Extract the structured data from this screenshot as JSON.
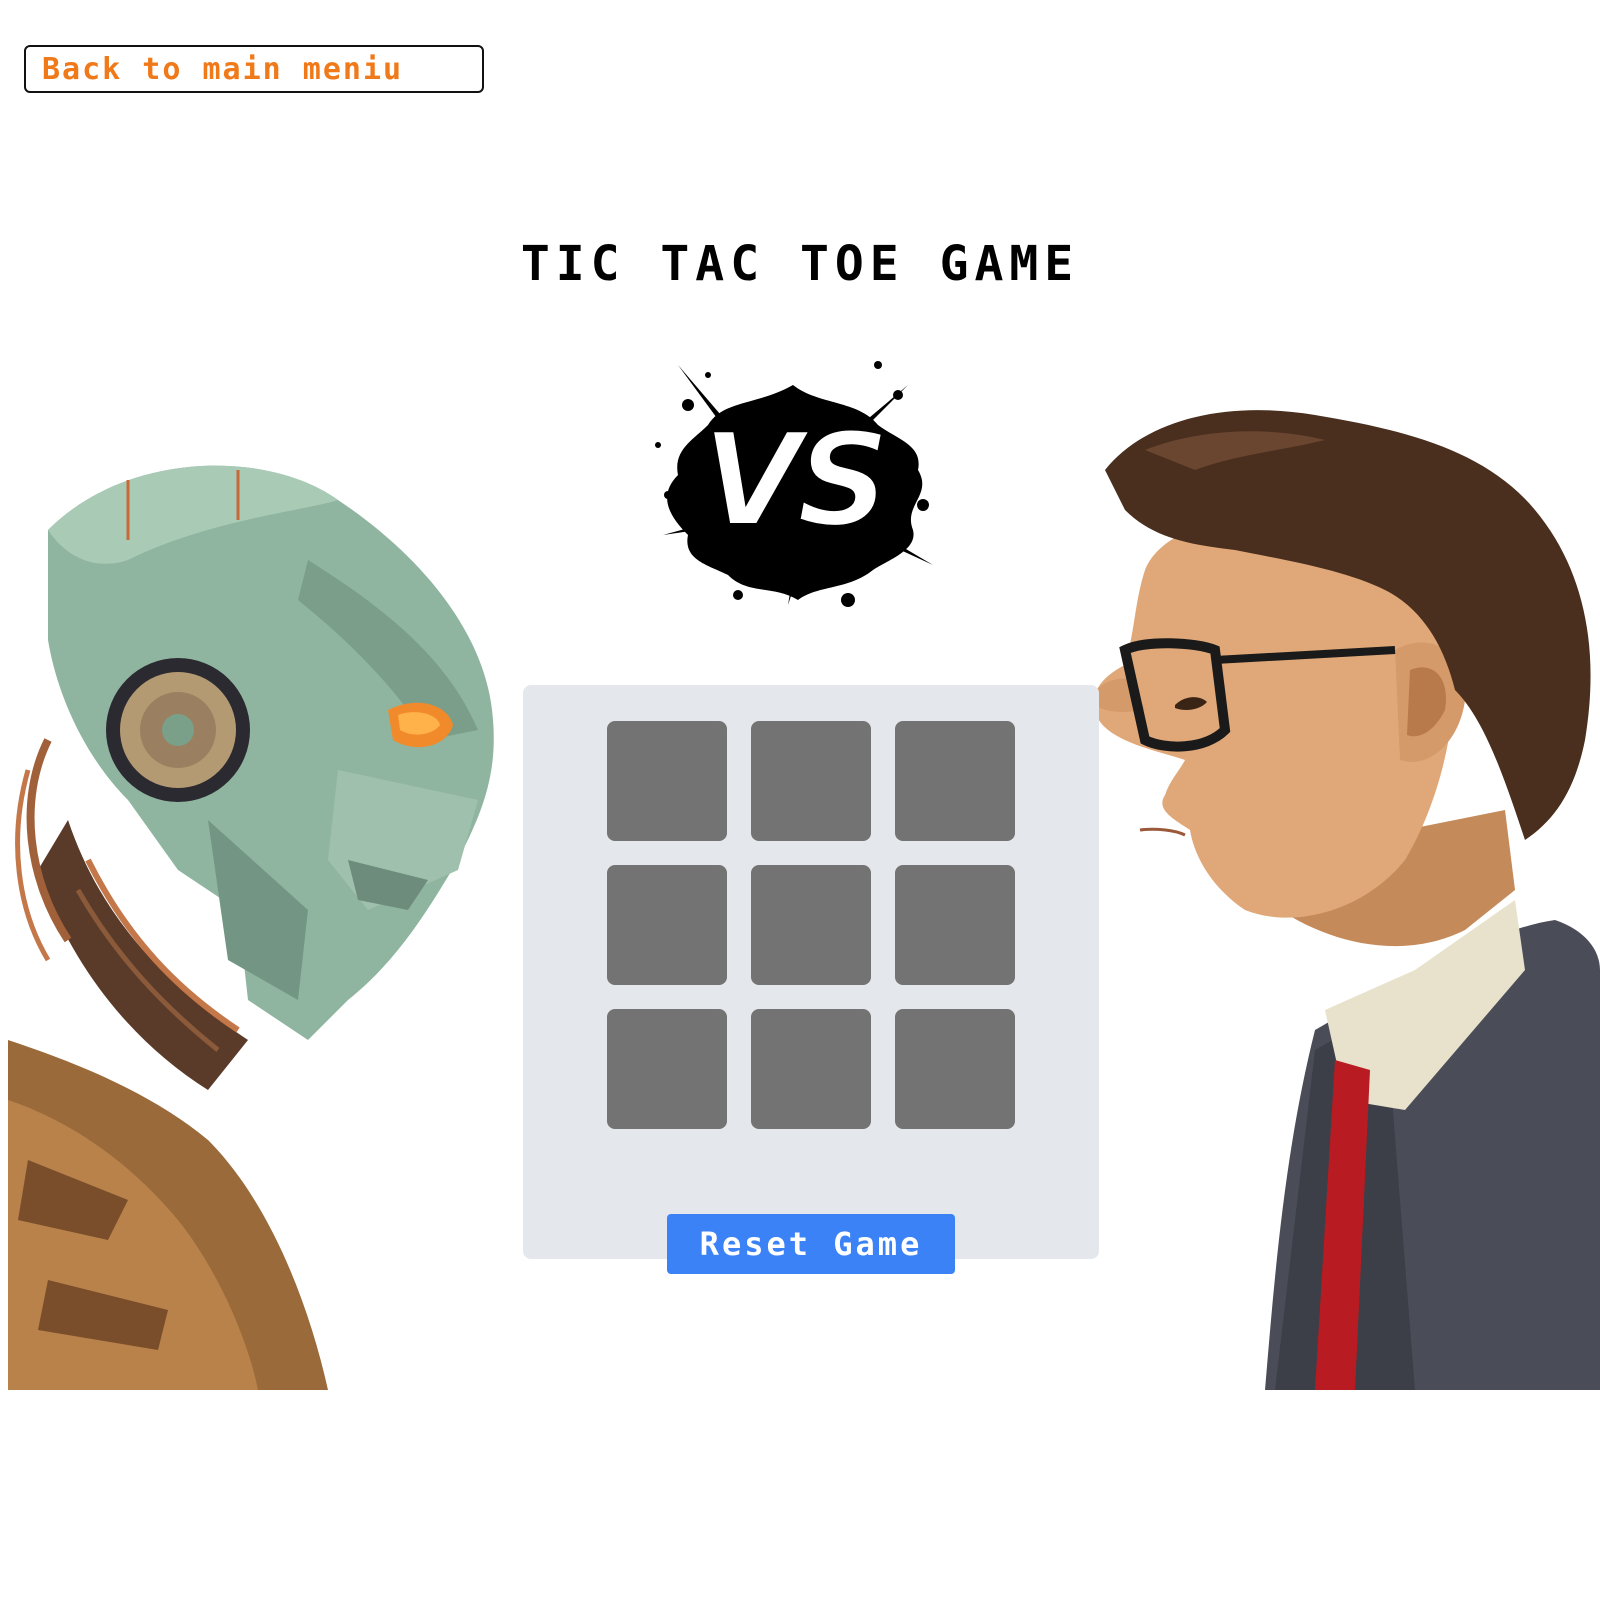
{
  "nav": {
    "back_label": "Back to main meniu"
  },
  "header": {
    "title": "TIC TAC TOE GAME"
  },
  "versus": {
    "label": "VS"
  },
  "board": {
    "cells": [
      "",
      "",
      "",
      "",
      "",
      "",
      "",
      "",
      ""
    ]
  },
  "controls": {
    "reset_label": "Reset Game"
  },
  "colors": {
    "back_text": "#f07a1a",
    "panel_bg": "#e4e7eb",
    "cell_bg": "#737373",
    "reset_bg": "#3b82f6"
  },
  "icons": {
    "left_player": "robot-portrait-icon",
    "right_player": "human-portrait-icon",
    "versus": "vs-splash-icon"
  }
}
